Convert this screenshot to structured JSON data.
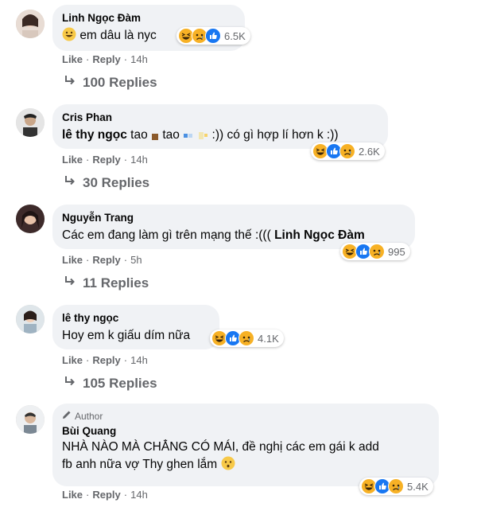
{
  "comments": [
    {
      "name": "Linh Ngọc Đàm",
      "text_emoji": "grin-emoji",
      "text": "em dâu là nyc",
      "react_count": "6.5K",
      "like": "Like",
      "reply": "Reply",
      "time": "14h",
      "replies": "100 Replies"
    },
    {
      "name": "Cris Phan",
      "mention": "lê thy ngọc",
      "text": "tao",
      "text2": "tao",
      "text3": ":)) có gì hợp lí hơn k :))",
      "react_count": "2.6K",
      "like": "Like",
      "reply": "Reply",
      "time": "14h",
      "replies": "30 Replies"
    },
    {
      "name": "Nguyễn Trang",
      "text": "Các em đang làm gì trên mạng thế :(((",
      "mention": "Linh Ngọc Đàm",
      "react_count": "995",
      "like": "Like",
      "reply": "Reply",
      "time": "5h",
      "replies": "11 Replies"
    },
    {
      "name": "lê thy ngọc",
      "text": "Hoy em k giấu dím nữa",
      "react_count": "4.1K",
      "like": "Like",
      "reply": "Reply",
      "time": "14h",
      "replies": "105 Replies"
    },
    {
      "badge": "Author",
      "name": "Bùi Quang",
      "text_line1": "NHÀ NÀO MÀ CHẲNG CÓ MÁI, đề nghị các em gái k add",
      "text_line2": "fb anh nữa vợ Thy ghen lắm",
      "react_count": "5.4K",
      "like": "Like",
      "reply": "Reply",
      "time": "14h"
    }
  ],
  "colors": {
    "bubble": "#f0f2f5",
    "meta_text": "#65676b",
    "like_blue": "#1877f2",
    "haha_yellow": "#f7b125",
    "sad_yellow": "#f7b125"
  },
  "reaction_icons": [
    "haha-icon",
    "like-icon",
    "sad-icon"
  ]
}
